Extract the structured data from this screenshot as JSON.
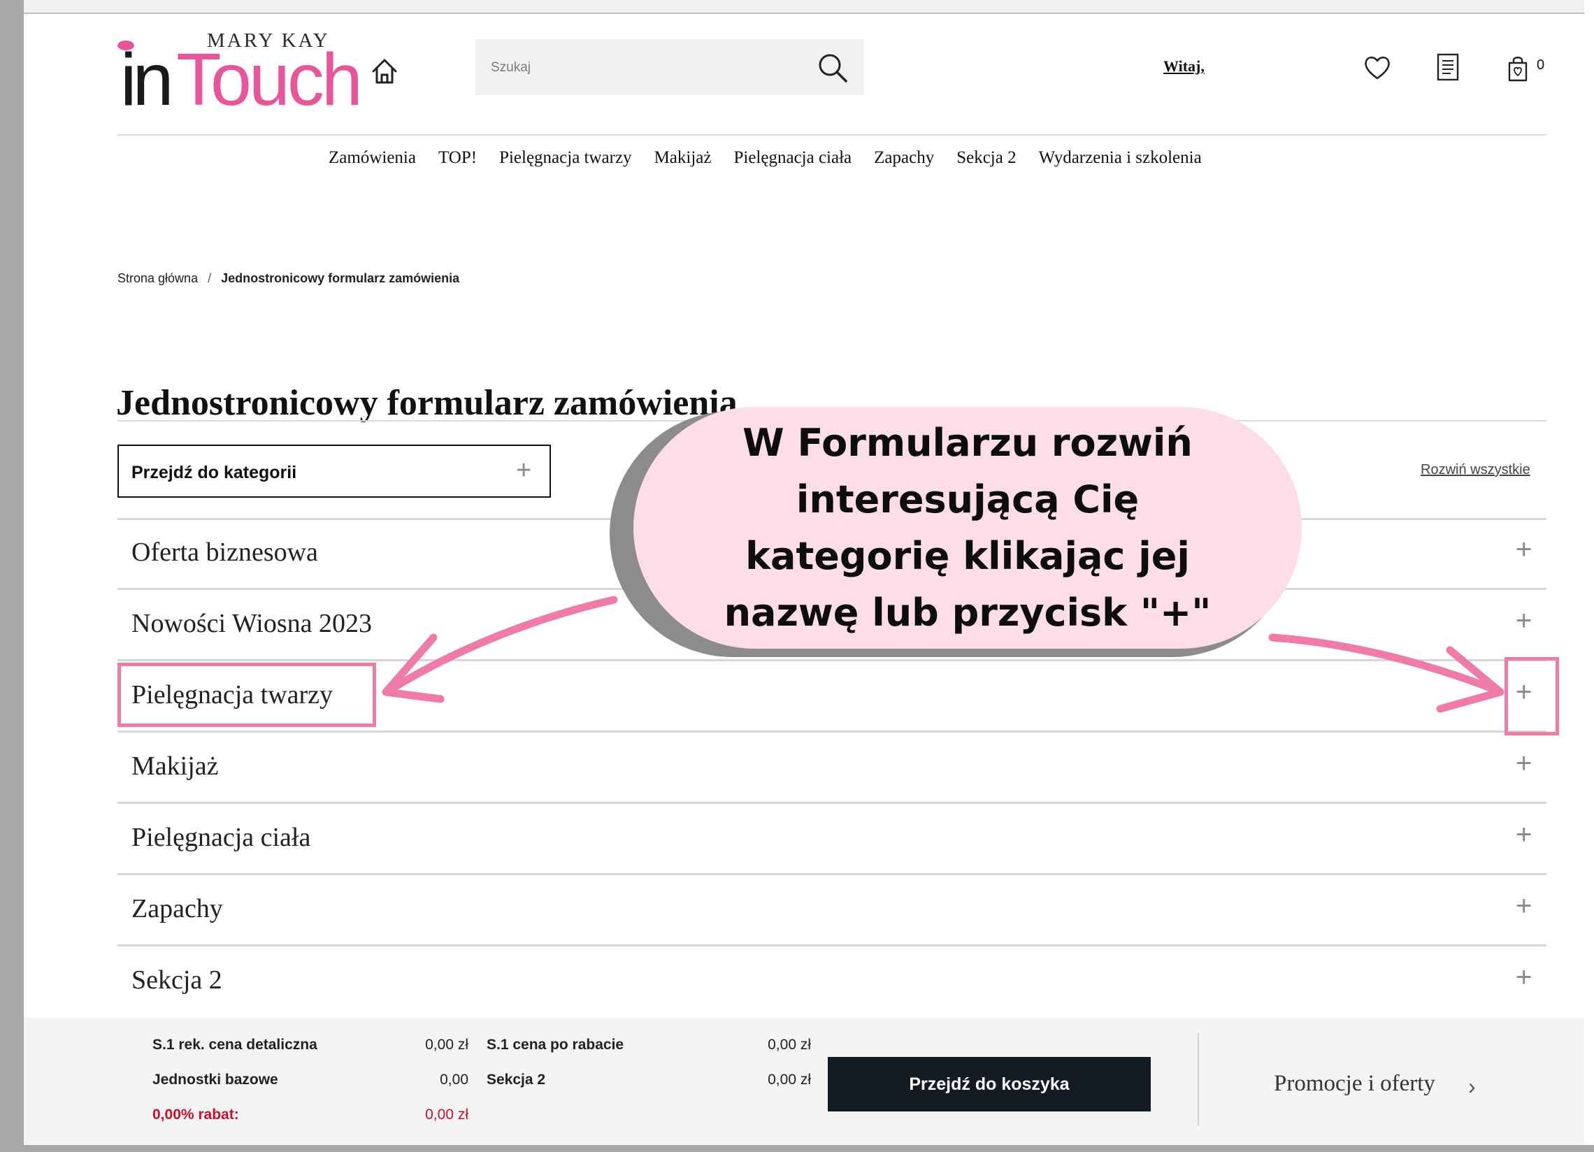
{
  "header": {
    "logo_brand": "MARY KAY",
    "logo_in": "in",
    "logo_touch": "Touch",
    "search_placeholder": "Szukaj",
    "greeting": "Witaj,",
    "cart_count": "0",
    "icons": [
      "home-icon",
      "search-icon",
      "heart-icon",
      "list-icon",
      "bag-icon"
    ]
  },
  "nav": {
    "items": [
      "Zamówienia",
      "TOP!",
      "Pielęgnacja twarzy",
      "Makijaż",
      "Pielęgnacja ciała",
      "Zapachy",
      "Sekcja 2",
      "Wydarzenia i szkolenia"
    ]
  },
  "breadcrumb": {
    "home": "Strona główna",
    "separator": "/",
    "current": "Jednostronicowy formularz zamówienia"
  },
  "page": {
    "title": "Jednostronicowy formularz zamówienia",
    "category_select_label": "Przejdź do kategorii",
    "expand_all": "Rozwiń wszystkie",
    "plus": "+"
  },
  "categories": [
    {
      "label": "Oferta biznesowa"
    },
    {
      "label": "Nowości Wiosna 2023"
    },
    {
      "label": "Pielęgnacja twarzy"
    },
    {
      "label": "Makijaż"
    },
    {
      "label": "Pielęgnacja ciała"
    },
    {
      "label": "Zapachy"
    },
    {
      "label": "Sekcja 2"
    }
  ],
  "annotation": {
    "text": "W Formularzu rozwiń interesującą Cię kategorię klikając jej nazwę lub przycisk \"+\"",
    "bubble_color": "#fcdde9",
    "highlight_color": "#ef7ba8"
  },
  "summary": {
    "rows": [
      {
        "label1": "S.1 rek. cena detaliczna",
        "value1": "0,00 zł",
        "label2": "S.1 cena po rabacie",
        "value2": "0,00 zł"
      },
      {
        "label1": "Jednostki bazowe",
        "value1": "0,00",
        "label2": "Sekcja 2",
        "value2": "0,00 zł"
      },
      {
        "label1": "0,00% rabat:",
        "value1": "0,00 zł"
      }
    ],
    "cart_button": "Przejdź do koszyka",
    "promo_link": "Promocje i oferty",
    "accent_red": "#c8102e",
    "button_color": "#141a24"
  }
}
